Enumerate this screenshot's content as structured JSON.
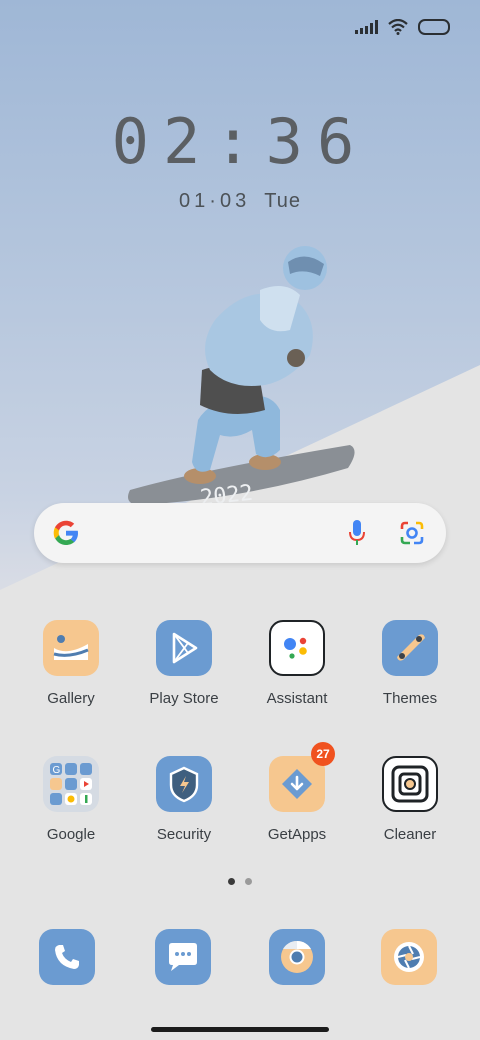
{
  "status": {
    "signal_icon": "signal-bars-icon",
    "wifi_icon": "wifi-icon",
    "battery_icon": "battery-icon"
  },
  "lock": {
    "time": "02:36",
    "date_day": "03",
    "date_month": "01",
    "weekday": "Tue"
  },
  "wallpaper": {
    "board_text": "2022"
  },
  "search": {
    "google_icon": "google-g-icon",
    "mic_icon": "mic-icon",
    "lens_icon": "lens-camera-icon"
  },
  "apps": [
    {
      "label": "Gallery"
    },
    {
      "label": "Play Store"
    },
    {
      "label": "Assistant"
    },
    {
      "label": "Themes"
    },
    {
      "label": "Google"
    },
    {
      "label": "Security"
    },
    {
      "label": "GetApps",
      "badge": "27"
    },
    {
      "label": "Cleaner"
    }
  ],
  "pages": {
    "count": 2,
    "current": 1
  },
  "colors": {
    "accent_blue": "#6b9bd1",
    "accent_peach": "#f6c78f",
    "badge": "#f0521f"
  }
}
